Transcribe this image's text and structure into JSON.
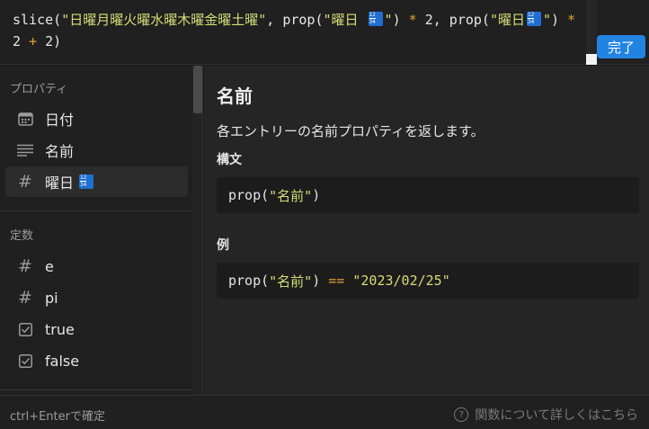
{
  "editor": {
    "code": {
      "fn_slice": "slice(",
      "str_days": "\"日曜月曜火曜水曜木曜金曜土曜\"",
      "sep1": ", ",
      "fn_prop1": "prop(",
      "str_prop1_a": "\"曜日 ",
      "str_prop1_b": "\"",
      "close1": ") ",
      "op_mul1": "*",
      "num_2a": " 2, ",
      "fn_prop2": "prop(",
      "str_prop2_a": "\"曜日",
      "str_prop2_b": "\"",
      "close2": ") ",
      "op_mul2": "*",
      "num_2b": " 2 ",
      "op_plus": "+",
      "num_2c": " 2)"
    },
    "done_label": "完了"
  },
  "sidebar": {
    "properties_title": "プロパティ",
    "properties": [
      {
        "label": "日付",
        "icon": "calendar-icon"
      },
      {
        "label": "名前",
        "icon": "text-lines-icon"
      },
      {
        "label": "曜日",
        "icon": "hash-icon",
        "badge": "number-badge-icon",
        "selected": true
      }
    ],
    "constants_title": "定数",
    "constants": [
      {
        "label": "e",
        "icon": "hash-icon"
      },
      {
        "label": "pi",
        "icon": "hash-icon"
      },
      {
        "label": "true",
        "icon": "checkbox-icon"
      },
      {
        "label": "false",
        "icon": "checkbox-icon"
      }
    ]
  },
  "doc": {
    "title": "名前",
    "description": "各エントリーの名前プロパティを返します。",
    "syntax_heading": "構文",
    "syntax": {
      "fn": "prop(",
      "str": "\"名前\"",
      "close": ")"
    },
    "example_heading": "例",
    "example": {
      "fn": "prop(",
      "str": "\"名前\"",
      "close": ") ",
      "op": "==",
      "sp": " ",
      "value": "\"2023/02/25\""
    }
  },
  "footer": {
    "hint": "ctrl+Enterで確定",
    "help_link": "関数について詳しくはこちら"
  },
  "colors": {
    "accent": "#2383e2",
    "string": "#d2de78",
    "operator": "#e9a23b",
    "background": "#191919"
  }
}
